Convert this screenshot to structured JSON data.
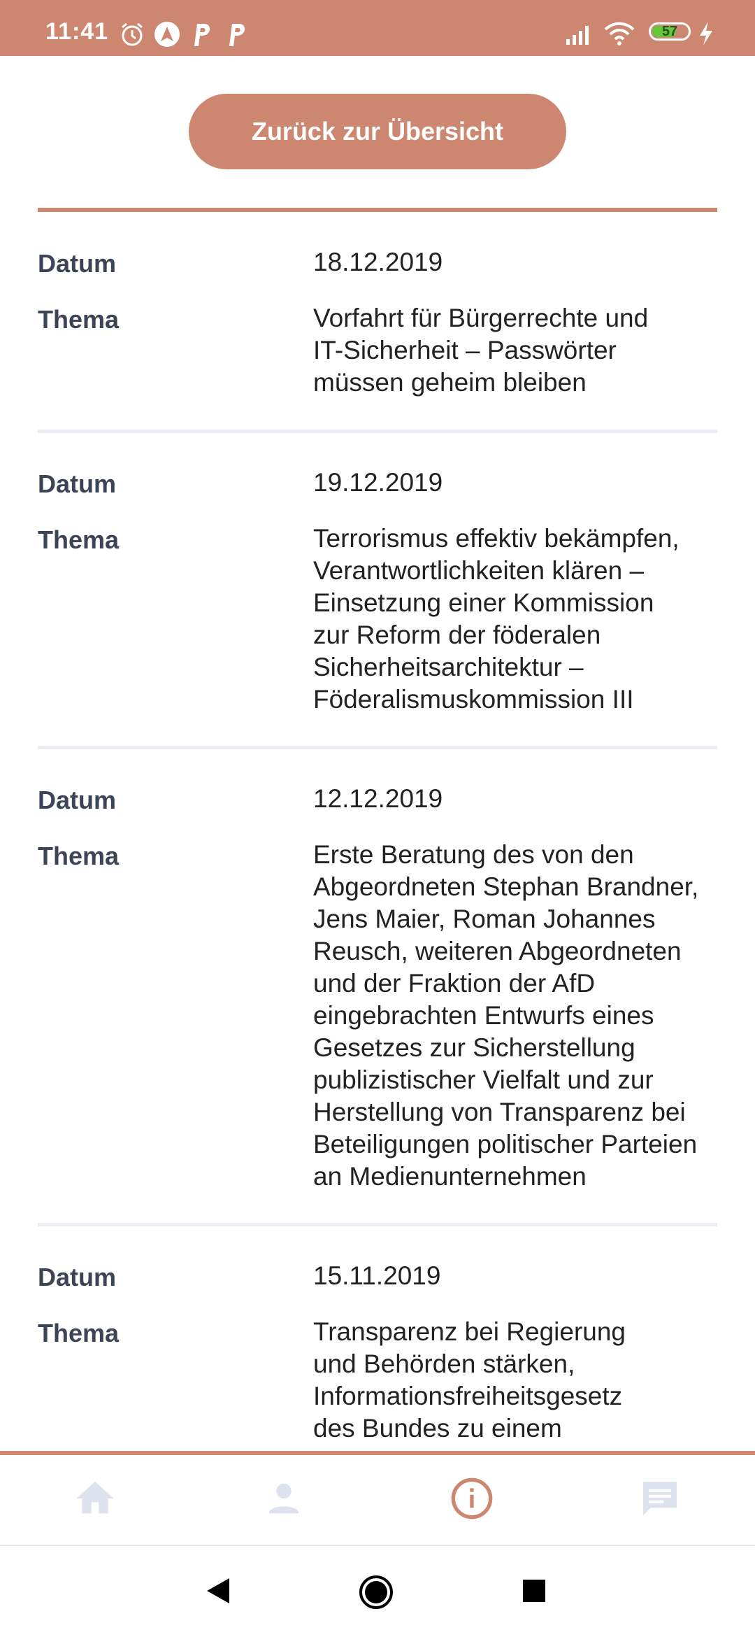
{
  "status_bar": {
    "time": "11:41",
    "icons": [
      "alarm-icon",
      "nav-app-icon",
      "p-icon",
      "p-icon",
      "signal-icon",
      "wifi-icon",
      "charging-icon"
    ],
    "battery": "57"
  },
  "back_button": "Zurück zur Übersicht",
  "entries": [
    {
      "date_label": "Datum",
      "date": "18.12.2019",
      "topic_label": "Thema",
      "topic_lines": [
        "Vorfahrt für Bürgerrechte und",
        "IT-Sicherheit – Passwörter",
        "müssen geheim bleiben"
      ]
    },
    {
      "date_label": "Datum",
      "date": "19.12.2019",
      "topic_label": "Thema",
      "topic_lines": [
        "Terrorismus effektiv bekämpfen,",
        "Verantwortlichkeiten klären –",
        "Einsetzung einer Kommission",
        "zur Reform der föderalen",
        "Sicherheitsarchitektur –",
        "Föderalismuskommission III"
      ]
    },
    {
      "date_label": "Datum",
      "date": "12.12.2019",
      "topic_label": "Thema",
      "topic_lines": [
        "Erste Beratung des von den",
        "Abgeordneten Stephan Brandner,",
        "Jens Maier, Roman Johannes",
        "Reusch, weiteren Abgeordneten",
        "und der Fraktion der AfD",
        "eingebrachten Entwurfs eines",
        "Gesetzes zur Sicherstellung",
        "publizistischer Vielfalt und zur",
        "Herstellung von Transparenz bei",
        "Beteiligungen politischer Parteien",
        "an Medienunternehmen"
      ]
    },
    {
      "date_label": "Datum",
      "date": "15.11.2019",
      "topic_label": "Thema",
      "topic_lines": [
        "Transparenz bei Regierung",
        "und Behörden stärken,",
        "Informationsfreiheitsgesetz",
        "des Bundes zu einem"
      ]
    }
  ],
  "bottom_nav": [
    {
      "icon": "home-icon",
      "active": false
    },
    {
      "icon": "person-icon",
      "active": false
    },
    {
      "icon": "info-icon",
      "active": true
    },
    {
      "icon": "chat-icon",
      "active": false
    }
  ],
  "colors": {
    "accent": "#cd8770",
    "label": "#3b4556",
    "inactive_icon": "#dde2ee",
    "battery": "#64c83a"
  }
}
